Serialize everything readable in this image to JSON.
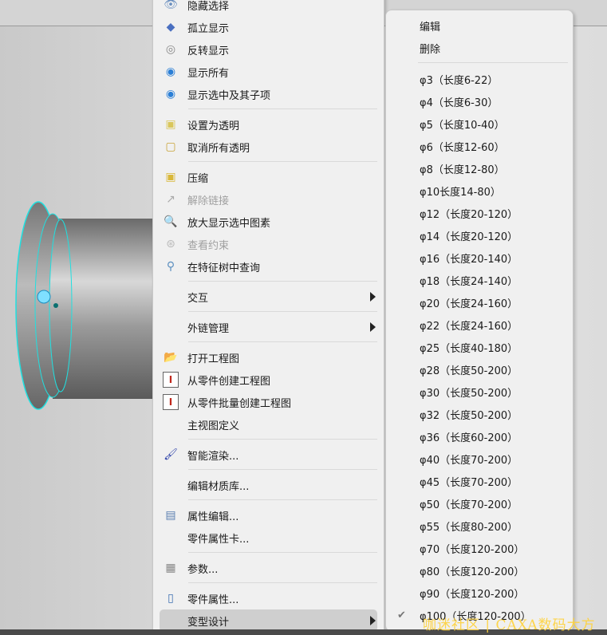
{
  "main_menu": [
    {
      "label": "隐藏选择",
      "icon": "hide-selection-icon",
      "glyph": "👁",
      "color": "#6a8fbf"
    },
    {
      "label": "孤立显示",
      "icon": "isolate-display-icon",
      "glyph": "◆",
      "color": "#4a6fc0"
    },
    {
      "label": "反转显示",
      "icon": "invert-display-icon",
      "glyph": "◎",
      "color": "#888"
    },
    {
      "label": "显示所有",
      "icon": "show-all-eye-icon",
      "glyph": "◉",
      "color": "#2b7fd6"
    },
    {
      "label": "显示选中及其子项",
      "icon": "show-selected-eye-icon",
      "glyph": "◉",
      "color": "#2b7fd6"
    },
    {
      "sep": true
    },
    {
      "label": "设置为透明",
      "icon": "set-transparent-icon",
      "glyph": "▣",
      "color": "#d9c65a"
    },
    {
      "label": "取消所有透明",
      "icon": "cancel-transparent-icon",
      "glyph": "▢",
      "color": "#c9a43a"
    },
    {
      "sep": true
    },
    {
      "label": "压缩",
      "icon": "compress-icon",
      "glyph": "▣",
      "color": "#d9b83a"
    },
    {
      "label": "解除链接",
      "icon": "unlink-icon",
      "glyph": "↗",
      "color": "#aaa",
      "disabled": true
    },
    {
      "label": "放大显示选中图素",
      "icon": "zoom-selected-magnifier-icon",
      "glyph": "🔍",
      "color": "#333"
    },
    {
      "label": "查看约束",
      "icon": "view-constraint-icon",
      "glyph": "⊛",
      "color": "#bbb",
      "disabled": true
    },
    {
      "label": "在特征树中查询",
      "icon": "feature-tree-query-icon",
      "glyph": "⚲",
      "color": "#5b8fc0"
    },
    {
      "sep": true
    },
    {
      "label": "交互",
      "submenu": true
    },
    {
      "sep": true
    },
    {
      "label": "外链管理",
      "submenu": true
    },
    {
      "sep": true
    },
    {
      "label": "打开工程图",
      "icon": "open-drawing-folder-icon",
      "glyph": "📂",
      "color": "#c9a43a"
    },
    {
      "label": "从零件创建工程图",
      "icon": "create-drawing-icon",
      "glyph": "I",
      "color": "#c0281c"
    },
    {
      "label": "从零件批量创建工程图",
      "icon": "batch-create-drawing-icon",
      "glyph": "I",
      "color": "#c0281c"
    },
    {
      "label": "主视图定义"
    },
    {
      "sep": true
    },
    {
      "label": "智能渲染...",
      "icon": "render-brush-icon",
      "glyph": "🖌",
      "color": "#2b3fa8"
    },
    {
      "sep": true
    },
    {
      "label": "编辑材质库..."
    },
    {
      "sep": true
    },
    {
      "label": "属性编辑...",
      "icon": "property-edit-icon",
      "glyph": "▤",
      "color": "#5b7fb0"
    },
    {
      "label": "零件属性卡..."
    },
    {
      "sep": true
    },
    {
      "label": "参数...",
      "icon": "parameters-table-icon",
      "glyph": "▦",
      "color": "#888"
    },
    {
      "sep": true
    },
    {
      "label": "零件属性...",
      "icon": "part-properties-icon",
      "glyph": "▯",
      "color": "#3c6fb0"
    },
    {
      "label": "变型设计",
      "submenu": true,
      "highlighted": true
    }
  ],
  "sub_menu": [
    {
      "label": "编辑"
    },
    {
      "label": "删除"
    },
    {
      "sep": true
    },
    {
      "label": "φ3（长度6-22）"
    },
    {
      "label": "φ4（长度6-30）"
    },
    {
      "label": "φ5（长度10-40）"
    },
    {
      "label": "φ6（长度12-60）"
    },
    {
      "label": "φ8（长度12-80）"
    },
    {
      "label": "φ10长度14-80）"
    },
    {
      "label": "φ12（长度20-120）"
    },
    {
      "label": "φ14（长度20-120）"
    },
    {
      "label": "φ16（长度20-140）"
    },
    {
      "label": "φ18（长度24-140）"
    },
    {
      "label": "φ20（长度24-160）"
    },
    {
      "label": "φ22（长度24-160）"
    },
    {
      "label": "φ25（长度40-180）"
    },
    {
      "label": "φ28（长度50-200）"
    },
    {
      "label": "φ30（长度50-200）"
    },
    {
      "label": "φ32（长度50-200）"
    },
    {
      "label": "φ36（长度60-200）"
    },
    {
      "label": "φ40（长度70-200）"
    },
    {
      "label": "φ45（长度70-200）"
    },
    {
      "label": "φ50（长度70-200）"
    },
    {
      "label": "φ55（长度80-200）"
    },
    {
      "label": "φ70（长度120-200）"
    },
    {
      "label": "φ80（长度120-200）"
    },
    {
      "label": "φ90（长度120-200）"
    },
    {
      "label": "φ100（长度120-200）",
      "checked": true
    }
  ],
  "watermark": "咖迷社区 | CAXA数码大方"
}
